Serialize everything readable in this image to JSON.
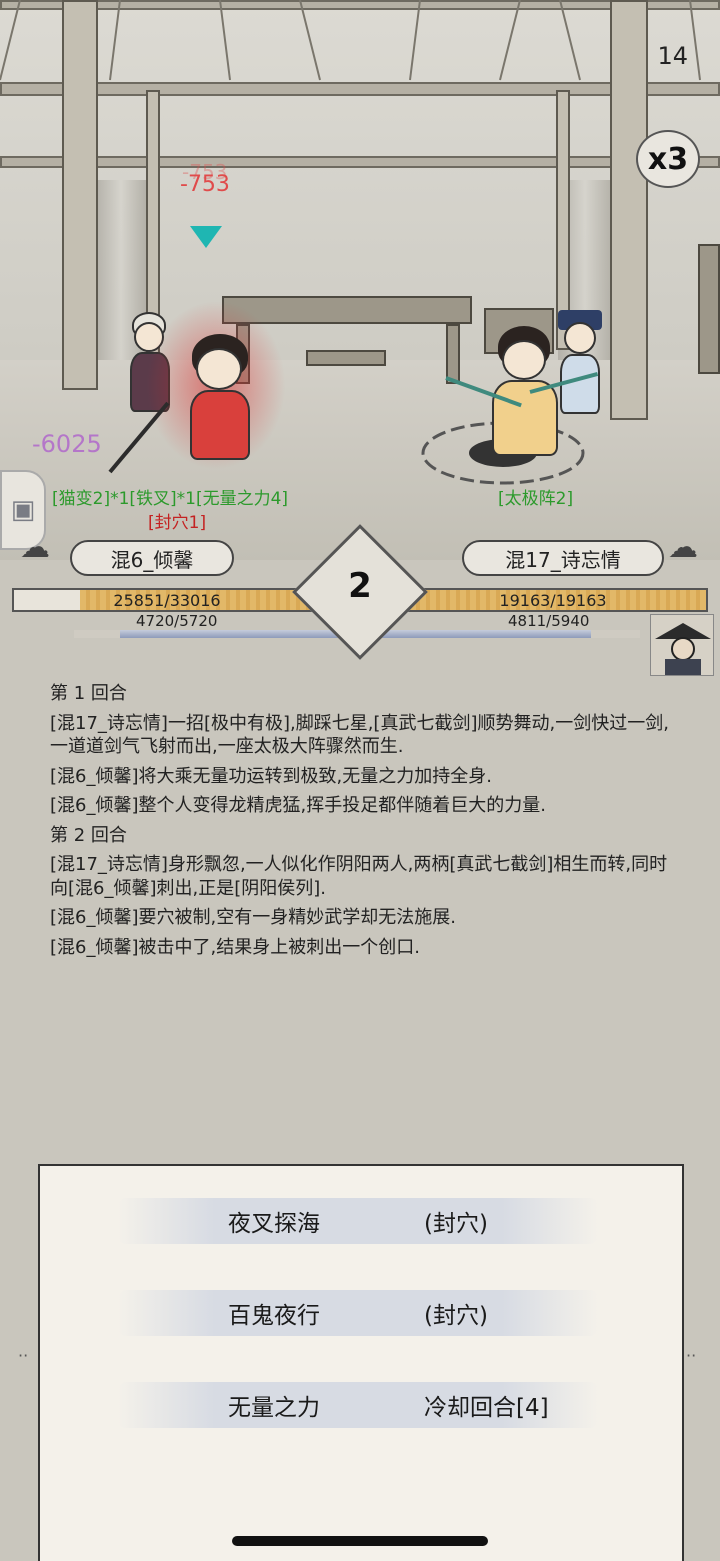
{
  "battle": {
    "speed_counter": "14",
    "speed_multiplier": "x3",
    "damage_float": "-753",
    "player_damage": "-6025",
    "left_buffs": "[猫变2]*1[铁叉]*1[无量之力4]",
    "left_debuff": "[封穴1]",
    "right_buffs": "[太极阵2]"
  },
  "hud": {
    "left_name": "混6_倾馨",
    "right_name": "混17_诗忘情",
    "round": "2",
    "left_hp": "25851/33016",
    "left_hp_ratio": 0.783,
    "left_mp": "4720/5720",
    "left_mp_ratio": 0.825,
    "right_hp": "19163/19163",
    "right_hp_ratio": 1.0,
    "right_mp": "4811/5940",
    "right_mp_ratio": 0.81
  },
  "log": [
    "第 1 回合",
    "[混17_诗忘情]一招[极中有极],脚踩七星,[真武七截剑]顺势舞动,一剑快过一剑,一道道剑气飞射而出,一座太极大阵骤然而生.",
    "[混6_倾馨]将大乘无量功运转到极致,无量之力加持全身.",
    "[混6_倾馨]整个人变得龙精虎猛,挥手投足都伴随着巨大的力量.",
    "第 2 回合",
    "[混17_诗忘情]身形飘忽,一人似化作阴阳两人,两柄[真武七截剑]相生而转,同时向[混6_倾馨]刺出,正是[阴阳侯列].",
    "[混6_倾馨]要穴被制,空有一身精妙武学却无法施展.",
    "[混6_倾馨]被击中了,结果身上被刺出一个创口."
  ],
  "skills": [
    {
      "name": "夜叉探海",
      "status": "(封穴)"
    },
    {
      "name": "百鬼夜行",
      "status": "(封穴)"
    },
    {
      "name": "无量之力",
      "status": "冷却回合[4]"
    }
  ],
  "side_tab_icon": "bag-icon",
  "colors": {
    "buff_green": "#2c9a2c",
    "debuff_red": "#c42222",
    "damage_purple": "#b476c9",
    "hp_gold": "#e2b868",
    "marker_teal": "#1fb6b2"
  }
}
